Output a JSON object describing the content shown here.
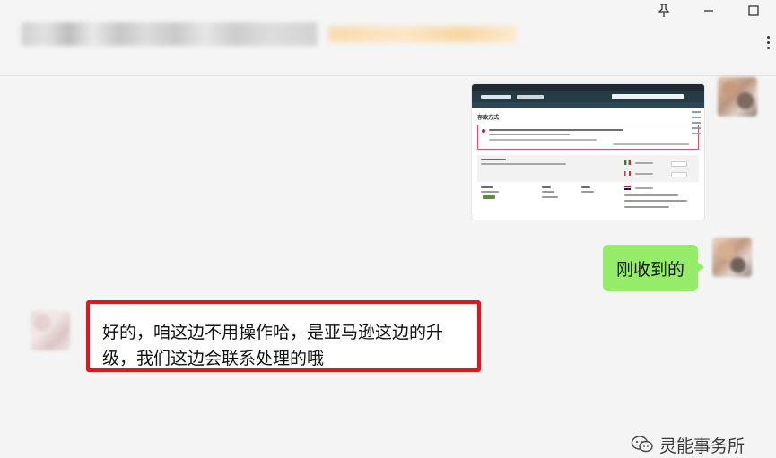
{
  "window": {
    "title_obscured": true,
    "controls": {
      "pin_icon": "pin-icon",
      "minimize_icon": "minimize-icon",
      "maximize_icon": "maximize-icon",
      "more_icon": "more-icon"
    }
  },
  "messages": [
    {
      "id": "img",
      "direction": "outgoing",
      "type": "image",
      "image": {
        "heading": "存款方式"
      }
    },
    {
      "id": "m1",
      "direction": "outgoing",
      "type": "text",
      "text": "刚收到的"
    },
    {
      "id": "m2",
      "direction": "incoming",
      "type": "text",
      "highlighted": true,
      "highlight_color": "#e8131d",
      "text": "好的，咱这边不用操作哈，是亚马逊这边的升级，我们这边会联系处理的哦"
    }
  ],
  "watermark": {
    "icon": "wechat-icon",
    "text": "灵能事务所"
  },
  "colors": {
    "outgoing_bubble": "#95ec69",
    "incoming_bubble": "#ffffff",
    "background": "#f4f4f4"
  }
}
